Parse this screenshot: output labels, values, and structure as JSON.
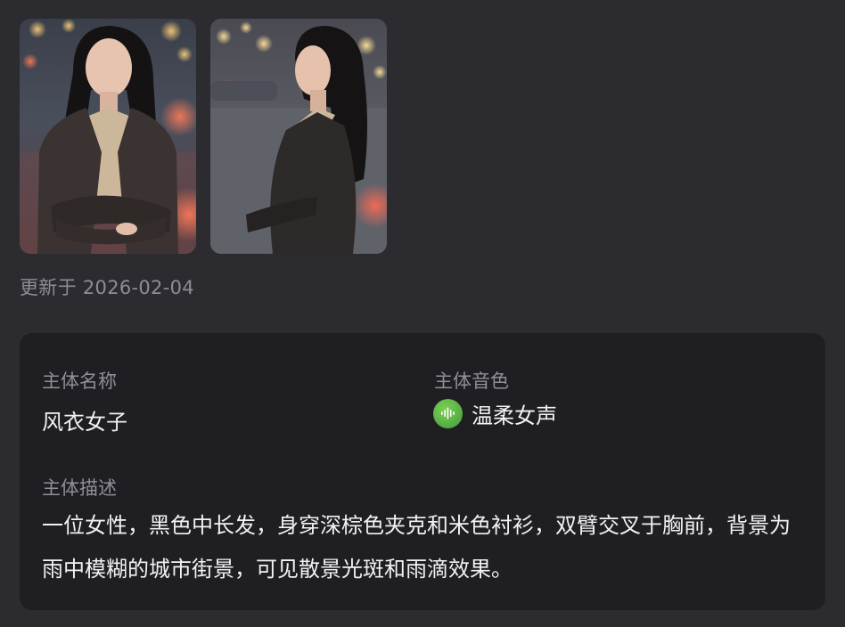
{
  "images": [
    {
      "name": "subject-image-1",
      "alt": ""
    },
    {
      "name": "subject-image-2",
      "alt": ""
    }
  ],
  "updated_text": "更新于 2026-02-04",
  "card": {
    "name_label": "主体名称",
    "name_value": "风衣女子",
    "voice_label": "主体音色",
    "voice_value": "温柔女声",
    "voice_icon": "audio-wave-icon",
    "desc_label": "主体描述",
    "desc_value": "一位女性，黑色中长发，身穿深棕色夹克和米色衬衫，双臂交叉于胸前，背景为雨中模糊的城市街景，可见散景光斑和雨滴效果。"
  },
  "colors": {
    "page_bg": "#2b2b30",
    "card_bg": "#1f1f23",
    "label": "#8f8f96",
    "text": "#f2f2f4",
    "voice_icon": "#4caf50"
  }
}
